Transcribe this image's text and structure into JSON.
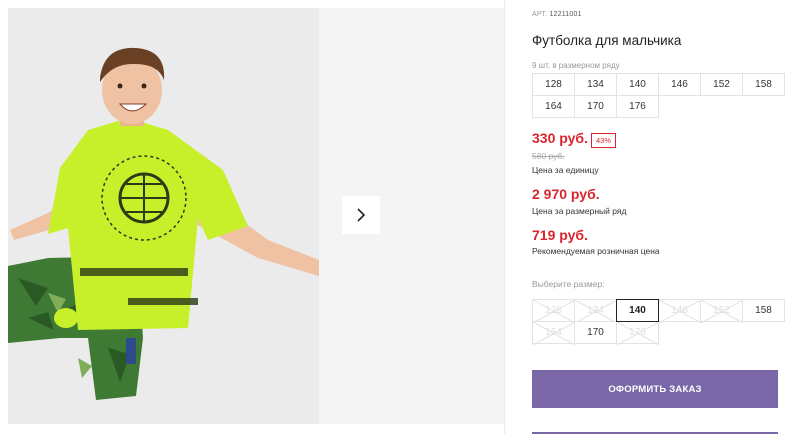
{
  "product": {
    "article_label": "АРТ.",
    "article_value": "12211001",
    "title": "Футболка для мальчика",
    "size_count": "9 шт. в размерном ряду",
    "size_row": [
      "128",
      "134",
      "140",
      "146",
      "152",
      "158",
      "164",
      "170",
      "176"
    ],
    "price": "330 руб.",
    "discount": "43%",
    "old_price": "580 руб.",
    "unit_label": "Цена за единицу",
    "row_price": "2 970 руб.",
    "row_label": "Цена за размерный ряд",
    "rrp": "719 руб.",
    "rrp_label": "Рекомендуемая розничная цена"
  },
  "size_picker": {
    "label": "Выберите размер:",
    "sizes": [
      {
        "label": "128",
        "state": "disabled"
      },
      {
        "label": "134",
        "state": "disabled"
      },
      {
        "label": "140",
        "state": "selected"
      },
      {
        "label": "146",
        "state": "disabled"
      },
      {
        "label": "152",
        "state": "disabled"
      },
      {
        "label": "158",
        "state": "available"
      },
      {
        "label": "164",
        "state": "disabled"
      },
      {
        "label": "170",
        "state": "available"
      },
      {
        "label": "176",
        "state": "disabled"
      }
    ]
  },
  "actions": {
    "order_label": "ОФОРМИТЬ ЗАКАЗ"
  },
  "colors": {
    "accent": "#7a67a8",
    "price": "#d8262c",
    "shirt": "#c8f02a"
  },
  "icons": {
    "next": "chevron-right-icon",
    "unavailable": "cross-out-icon"
  }
}
